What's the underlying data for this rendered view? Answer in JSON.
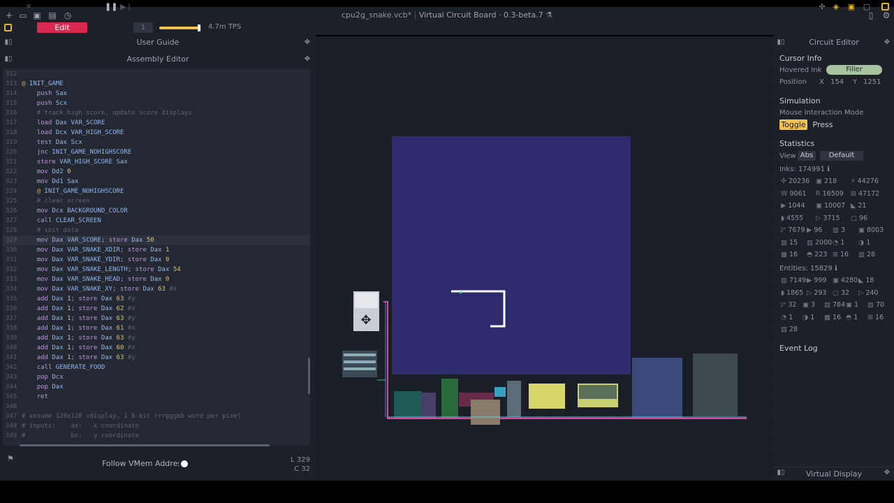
{
  "window": {
    "file": "cpu2g_snake.vcb*",
    "app": "Virtual Circuit Board · 0.3-beta.7"
  },
  "toolbar": {
    "edit_label": "Edit",
    "step_value": "1",
    "speed_fraction": 0.95,
    "tps": "4.7m TPS"
  },
  "panels": {
    "user_guide": "User Guide",
    "assembly_editor": "Assembly Editor",
    "circuit_editor": "Circuit Editor",
    "virtual_display": "Virtual Display"
  },
  "editor": {
    "highlighted_line": 329,
    "lines": [
      {
        "n": "312",
        "t": ""
      },
      {
        "n": "313",
        "t": "@ INIT_GAME"
      },
      {
        "n": "314",
        "t": "    push Sax"
      },
      {
        "n": "315",
        "t": "    push Scx"
      },
      {
        "n": "316",
        "t": "    # track high score, update score displays"
      },
      {
        "n": "317",
        "t": "    load Dax VAR_SCORE"
      },
      {
        "n": "318",
        "t": "    load Dcx VAR_HIGH_SCORE"
      },
      {
        "n": "319",
        "t": "    test Dax Scx"
      },
      {
        "n": "320",
        "t": "    jnc INIT_GAME_NOHIGHSCORE"
      },
      {
        "n": "321",
        "t": "    store VAR_HIGH_SCORE Sax"
      },
      {
        "n": "322",
        "t": "    mov Dd2 0"
      },
      {
        "n": "323",
        "t": "    mov Dd1 Sax"
      },
      {
        "n": "324",
        "t": "    @ INIT_GAME_NOHIGHSCORE"
      },
      {
        "n": "325",
        "t": "    # clear screen"
      },
      {
        "n": "326",
        "t": "    mov Dcx BACKGROUND_COLOR"
      },
      {
        "n": "327",
        "t": "    call CLEAR_SCREEN"
      },
      {
        "n": "328",
        "t": "    # init data"
      },
      {
        "n": "329",
        "t": "    mov Dax VAR_SCORE; store Dax 50"
      },
      {
        "n": "330",
        "t": "    mov Dax VAR_SNAKE_XDIR; store Dax 1"
      },
      {
        "n": "331",
        "t": "    mov Dax VAR_SNAKE_YDIR; store Dax 0"
      },
      {
        "n": "332",
        "t": "    mov Dax VAR_SNAKE_LENGTH; store Dax 54"
      },
      {
        "n": "333",
        "t": "    mov Dax VAR_SNAKE_HEAD; store Dax 0"
      },
      {
        "n": "334",
        "t": "    mov Dax VAR_SNAKE_XY; store Dax 63 #x"
      },
      {
        "n": "335",
        "t": "    add Dax 1; store Dax 63 #y"
      },
      {
        "n": "336",
        "t": "    add Dax 1; store Dax 62 #x"
      },
      {
        "n": "337",
        "t": "    add Dax 1; store Dax 63 #y"
      },
      {
        "n": "338",
        "t": "    add Dax 1; store Dax 61 #x"
      },
      {
        "n": "339",
        "t": "    add Dax 1; store Dax 63 #y"
      },
      {
        "n": "340",
        "t": "    add Dax 1; store Dax 60 #x"
      },
      {
        "n": "341",
        "t": "    add Dax 1; store Dax 63 #y"
      },
      {
        "n": "342",
        "t": "    call GENERATE_FOOD"
      },
      {
        "n": "343",
        "t": "    pop Dcx"
      },
      {
        "n": "344",
        "t": "    pop Dax"
      },
      {
        "n": "345",
        "t": "    ret"
      },
      {
        "n": "346",
        "t": ""
      },
      {
        "n": "347",
        "t": "# assume 128x128 vdisplay, 1 8-bit rrrgggbb word per pixel"
      },
      {
        "n": "348",
        "t": "# inputs:    ax:   x coordinate"
      },
      {
        "n": "349",
        "t": "#            bx:   y coordinate"
      }
    ],
    "follow_label": "Follow VMem Address",
    "follow_on": false,
    "cursor_line": "L 329",
    "cursor_col": "C 32"
  },
  "circuit_editor": {
    "cursor_info_title": "Cursor Info",
    "hovered_ink_label": "Hovered Ink",
    "hovered_ink_value": "Filler",
    "position_label": "Position",
    "pos_x_label": "X",
    "pos_x": "154",
    "pos_y_label": "Y",
    "pos_y": "1251",
    "simulation_title": "Simulation",
    "mouse_mode_label": "Mouse Interaction Mode",
    "toggle_label": "Toggle",
    "press_label": "Press",
    "statistics_title": "Statistics",
    "view_label": "View",
    "abs_label": "Abs",
    "default_label": "Default",
    "inks_label": "Inks: 174991",
    "ink_stats": [
      [
        "20236",
        "218",
        "44276"
      ],
      [
        "9061",
        "16509",
        "47172"
      ],
      [
        "1044",
        "10007",
        "21"
      ],
      [
        "4555",
        "3715",
        "96"
      ],
      [
        "7679",
        "96",
        "3",
        "8003"
      ],
      [
        "15",
        "2000",
        "1",
        "1"
      ],
      [
        "16",
        "223",
        "16",
        "28"
      ]
    ],
    "ink_glyphs": [
      [
        "✣",
        "▣",
        "⚡"
      ],
      [
        "W",
        "R",
        "⊞"
      ],
      [
        "▶",
        "▣",
        "◣"
      ],
      [
        "◗",
        "▷",
        "▢"
      ],
      [
        "◸",
        "▶",
        "▨",
        "▣"
      ],
      [
        "▧",
        "▥",
        "◔",
        "◑"
      ],
      [
        "▩",
        "◓",
        "⊞",
        "▧"
      ]
    ],
    "entities_label": "Entities: 15829",
    "entity_stats": [
      [
        "7149",
        "999",
        "4280",
        "18"
      ],
      [
        "1865",
        "293",
        "32",
        "240"
      ],
      [
        "32",
        "3",
        "784",
        "1",
        "70"
      ],
      [
        "1",
        "1",
        "16",
        "1",
        "16"
      ],
      [
        "28"
      ]
    ],
    "entity_glyphs": [
      [
        "▥",
        "▶",
        "▣",
        "◣"
      ],
      [
        "◗",
        "▷",
        "▢",
        "▷"
      ],
      [
        "◸",
        "▣",
        "▨",
        "▣",
        "▧"
      ],
      [
        "◔",
        "◑",
        "▩",
        "◓",
        "⊞"
      ],
      [
        "▧"
      ]
    ],
    "event_log_title": "Event Log"
  },
  "colors": {
    "accent_red": "#d92950",
    "accent_yellow": "#f2c14e",
    "display_bg": "#2e2a6e",
    "ink_pill": "#a7c4a0"
  }
}
